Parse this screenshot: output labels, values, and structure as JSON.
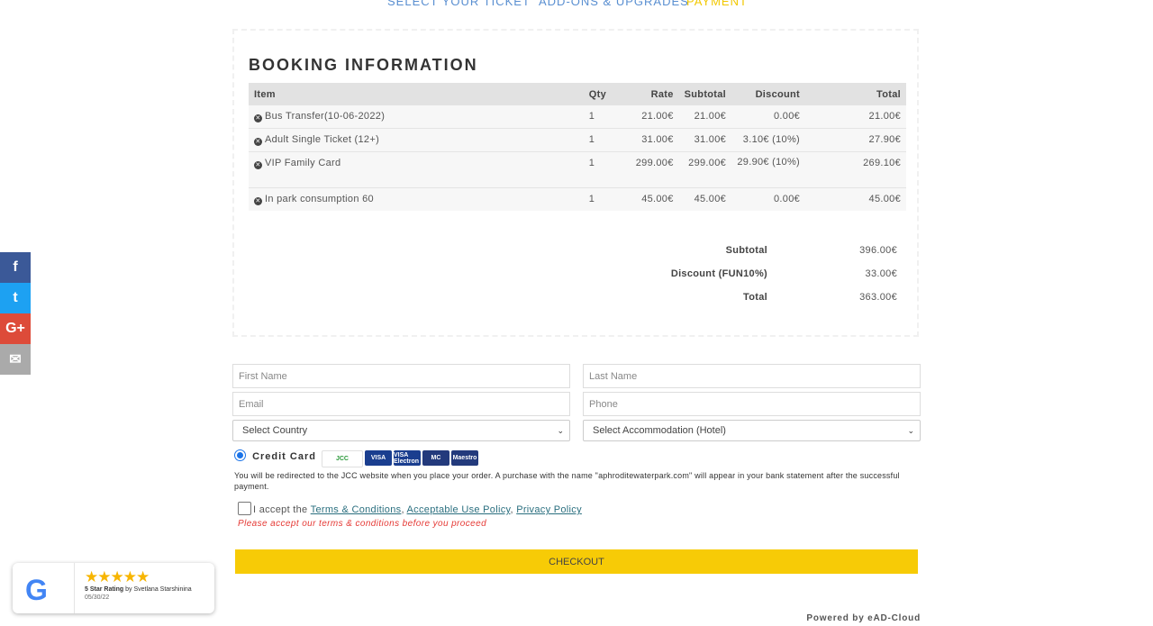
{
  "steps": {
    "select_ticket": "SELECT YOUR TICKET",
    "add_ons": "ADD-ONS & UPGRADES",
    "payment": "PAYMENT"
  },
  "booking": {
    "title": "BOOKING INFORMATION",
    "headers": {
      "item": "Item",
      "qty": "Qty",
      "rate": "Rate",
      "subtotal": "Subtotal",
      "discount": "Discount",
      "total": "Total"
    },
    "rows": [
      {
        "item": "Bus Transfer(10-06-2022)",
        "qty": "1",
        "rate": "21.00€",
        "subtotal": "21.00€",
        "discount": "0.00€",
        "total": "21.00€"
      },
      {
        "item": "Adult Single Ticket (12+)",
        "qty": "1",
        "rate": "31.00€",
        "subtotal": "31.00€",
        "discount": "3.10€ (10%)",
        "total": "27.90€"
      },
      {
        "item": "VIP Family Card",
        "qty": "1",
        "rate": "299.00€",
        "subtotal": "299.00€",
        "discount": "29.90€ (10%)",
        "total": "269.10€"
      },
      {
        "item": "In park consumption 60",
        "qty": "1",
        "rate": "45.00€",
        "subtotal": "45.00€",
        "discount": "0.00€",
        "total": "45.00€"
      }
    ],
    "summary": {
      "subtotal_label": "Subtotal",
      "subtotal_value": "396.00€",
      "discount_label": "Discount (FUN10%)",
      "discount_value": "33.00€",
      "total_label": "Total",
      "total_value": "363.00€"
    }
  },
  "social": {
    "facebook": "f",
    "twitter": "t",
    "google": "G+",
    "email": "✉"
  },
  "form": {
    "first_name_placeholder": "First Name",
    "last_name_placeholder": "Last Name",
    "email_placeholder": "Email",
    "phone_placeholder": "Phone",
    "country_selected": "Select Country",
    "accommodation_selected": "Select Accommodation (Hotel)"
  },
  "payment": {
    "method_label": "Credit Card",
    "cards": {
      "jcc": "JCC",
      "visa": "VISA",
      "visa_electron": "VISA Electron",
      "mastercard": "MC",
      "maestro": "Maestro"
    },
    "note": "You will be redirected to the JCC website when you place your order. A purchase with the name \"aphroditewaterpark.com\" will appear in your bank statement after the successful payment."
  },
  "terms": {
    "prefix": "I accept the",
    "terms_link": "Terms & Conditions",
    "sep1": ",",
    "aup_link": "Acceptable Use Policy",
    "sep2": ",",
    "privacy_link": "Privacy Policy",
    "warning": "Please accept our terms & conditions before you proceed"
  },
  "checkout_label": "CHECKOUT",
  "powered_by": "Powered by eAD-Cloud",
  "review": {
    "logo": "G",
    "stars": "★★★★★",
    "rating_text": "5 Star Rating",
    "by_text": "by Svetlana Starshinina",
    "date": "05/30/22"
  },
  "colors": {
    "accent": "#f7cb06",
    "link": "#2a6f7f",
    "warning": "#e53935"
  }
}
